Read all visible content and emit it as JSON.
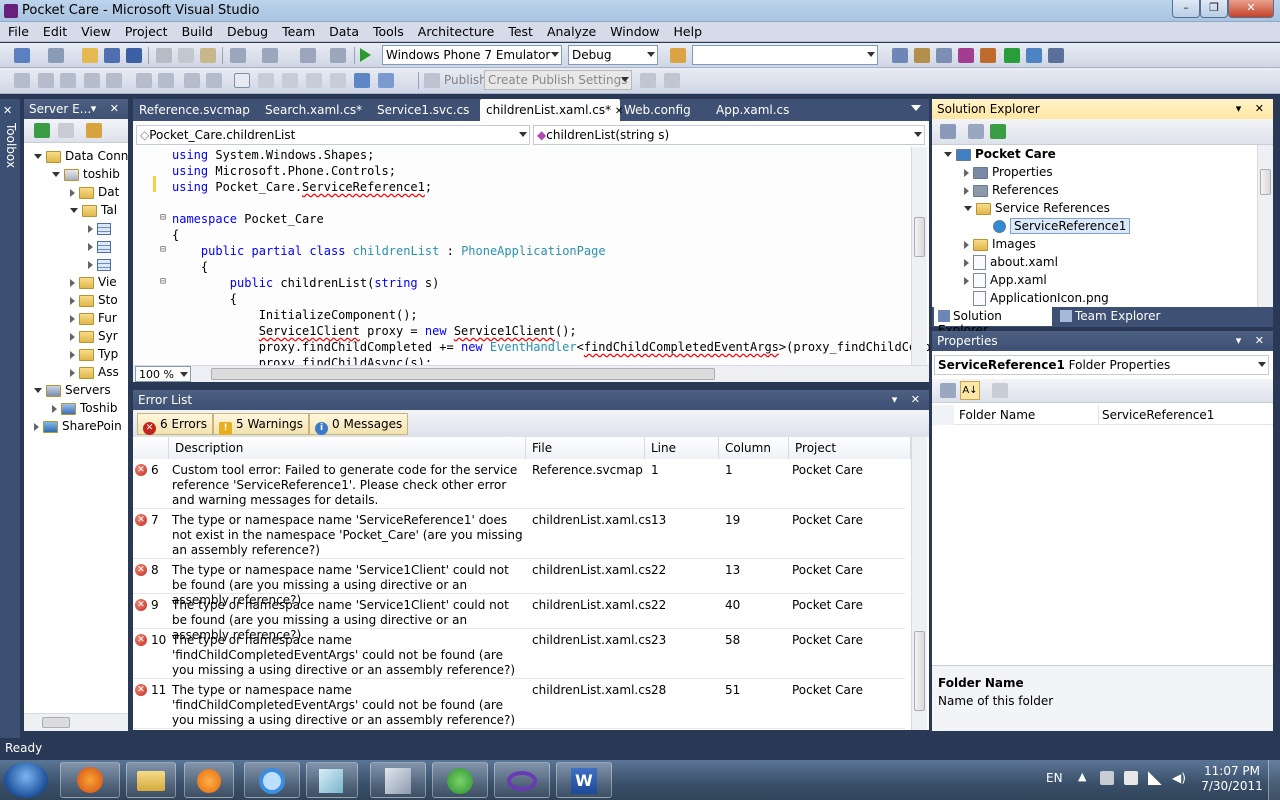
{
  "window": {
    "title": "Pocket Care - Microsoft Visual Studio",
    "min": "–",
    "max": "❐",
    "close": "✕"
  },
  "menu": [
    "File",
    "Edit",
    "View",
    "Project",
    "Build",
    "Debug",
    "Team",
    "Data",
    "Tools",
    "Architecture",
    "Test",
    "Analyze",
    "Window",
    "Help"
  ],
  "toolbar": {
    "target_device": "Windows Phone 7 Emulator",
    "configuration": "Debug",
    "search_value": "",
    "publish_label": "Publish:",
    "publish_settings": "Create Publish Settings"
  },
  "toolbox_label": "Toolbox",
  "server_explorer": {
    "title": "Server E...",
    "items": [
      {
        "label": "Data Conn",
        "level": 0,
        "icon": "folder",
        "expanded": true
      },
      {
        "label": "toshib",
        "level": 1,
        "icon": "db",
        "expanded": true
      },
      {
        "label": "Dat",
        "level": 2,
        "icon": "folder",
        "expanded": false
      },
      {
        "label": "Tal",
        "level": 2,
        "icon": "folder",
        "expanded": true
      },
      {
        "label": "",
        "level": 3,
        "icon": "table",
        "expanded": false
      },
      {
        "label": "",
        "level": 3,
        "icon": "table",
        "expanded": false
      },
      {
        "label": "",
        "level": 3,
        "icon": "table",
        "expanded": false
      },
      {
        "label": "Vie",
        "level": 2,
        "icon": "folder",
        "expanded": false
      },
      {
        "label": "Sto",
        "level": 2,
        "icon": "folder",
        "expanded": false
      },
      {
        "label": "Fur",
        "level": 2,
        "icon": "folder",
        "expanded": false
      },
      {
        "label": "Syr",
        "level": 2,
        "icon": "folder",
        "expanded": false
      },
      {
        "label": "Typ",
        "level": 2,
        "icon": "folder",
        "expanded": false
      },
      {
        "label": "Ass",
        "level": 2,
        "icon": "folder",
        "expanded": false
      },
      {
        "label": "Servers",
        "level": 0,
        "icon": "server",
        "expanded": true
      },
      {
        "label": "Toshib",
        "level": 1,
        "icon": "pc",
        "expanded": false
      },
      {
        "label": "SharePoin",
        "level": 0,
        "icon": "sp",
        "expanded": false
      }
    ]
  },
  "editor": {
    "tabs": [
      "Reference.svcmap",
      "Search.xaml.cs*",
      "Service1.svc.cs",
      "childrenList.xaml.cs*",
      "Web.config",
      "App.xaml.cs"
    ],
    "selected_tab": 3,
    "nav_type": "Pocket_Care.childrenList",
    "nav_member": "childrenList(string s)",
    "zoom": "100 %",
    "lines": [
      "using System.Windows.Shapes;",
      "using Microsoft.Phone.Controls;",
      "using Pocket_Care.ServiceReference1;",
      "",
      "namespace Pocket_Care",
      "{",
      "    public partial class childrenList : PhoneApplicationPage",
      "    {",
      "        public childrenList(string s)",
      "        {",
      "            InitializeComponent();",
      "            Service1Client proxy = new Service1Client();",
      "            proxy.findChildCompleted += new EventHandler<findChildCompletedEventArgs>(proxy_findChildComp",
      "            proxy.findChildAsync(s);"
    ]
  },
  "error_list": {
    "title": "Error List",
    "errors_btn": "6 Errors",
    "warnings_btn": "5 Warnings",
    "messages_btn": "0 Messages",
    "columns": [
      "Description",
      "File",
      "Line",
      "Column",
      "Project"
    ],
    "rows": [
      {
        "num": "6",
        "desc": "Custom tool error: Failed to generate code for the service reference 'ServiceReference1'.  Please check other error and warning messages for details.",
        "file": "Reference.svcmap",
        "line": "1",
        "col": "1",
        "project": "Pocket Care"
      },
      {
        "num": "7",
        "desc": "The type or namespace name 'ServiceReference1' does not exist in the namespace 'Pocket_Care' (are you missing an assembly reference?)",
        "file": "childrenList.xaml.cs",
        "line": "13",
        "col": "19",
        "project": "Pocket Care"
      },
      {
        "num": "8",
        "desc": "The type or namespace name 'Service1Client' could not be found (are you missing a using directive or an assembly reference?)",
        "file": "childrenList.xaml.cs",
        "line": "22",
        "col": "13",
        "project": "Pocket Care"
      },
      {
        "num": "9",
        "desc": "The type or namespace name 'Service1Client' could not be found (are you missing a using directive or an assembly reference?)",
        "file": "childrenList.xaml.cs",
        "line": "22",
        "col": "40",
        "project": "Pocket Care"
      },
      {
        "num": "10",
        "desc": "The type or namespace name 'findChildCompletedEventArgs' could not be found (are you missing a using directive or an assembly reference?)",
        "file": "childrenList.xaml.cs",
        "line": "23",
        "col": "58",
        "project": "Pocket Care"
      },
      {
        "num": "11",
        "desc": "The type or namespace name 'findChildCompletedEventArgs' could not be found (are you missing a using directive or an assembly reference?)",
        "file": "childrenList.xaml.cs",
        "line": "28",
        "col": "51",
        "project": "Pocket Care"
      }
    ]
  },
  "solution_explorer": {
    "title": "Solution Explorer",
    "items": [
      {
        "label": "Pocket Care",
        "level": 0,
        "bold": true,
        "expanded": true,
        "icon": "project"
      },
      {
        "label": "Properties",
        "level": 1,
        "expanded": false,
        "icon": "props"
      },
      {
        "label": "References",
        "level": 1,
        "expanded": false,
        "icon": "refs"
      },
      {
        "label": "Service References",
        "level": 1,
        "expanded": true,
        "icon": "folder"
      },
      {
        "label": "ServiceReference1",
        "level": 2,
        "selected": true,
        "icon": "globe"
      },
      {
        "label": "Images",
        "level": 1,
        "expanded": false,
        "icon": "folder"
      },
      {
        "label": "about.xaml",
        "level": 1,
        "expanded": false,
        "icon": "file"
      },
      {
        "label": "App.xaml",
        "level": 1,
        "expanded": false,
        "icon": "file"
      },
      {
        "label": "ApplicationIcon.png",
        "level": 1,
        "icon": "file"
      }
    ],
    "tab_solution": "Solution Explorer",
    "tab_team": "Team Explorer"
  },
  "properties": {
    "title": "Properties",
    "object_name": "ServiceReference1",
    "object_type": "Folder Properties",
    "rows": [
      {
        "name": "Folder Name",
        "value": "ServiceReference1"
      }
    ],
    "desc_title": "Folder Name",
    "desc_text": "Name of this folder"
  },
  "status": {
    "text": "Ready"
  },
  "taskbar": {
    "lang": "EN",
    "time": "11:07 PM",
    "date": "7/30/2011"
  },
  "colors": {
    "chrome": "#293955",
    "active_header": "#ffe8a6",
    "keyword": "#0000ff",
    "type": "#2b91af",
    "error": "#c3261a"
  }
}
